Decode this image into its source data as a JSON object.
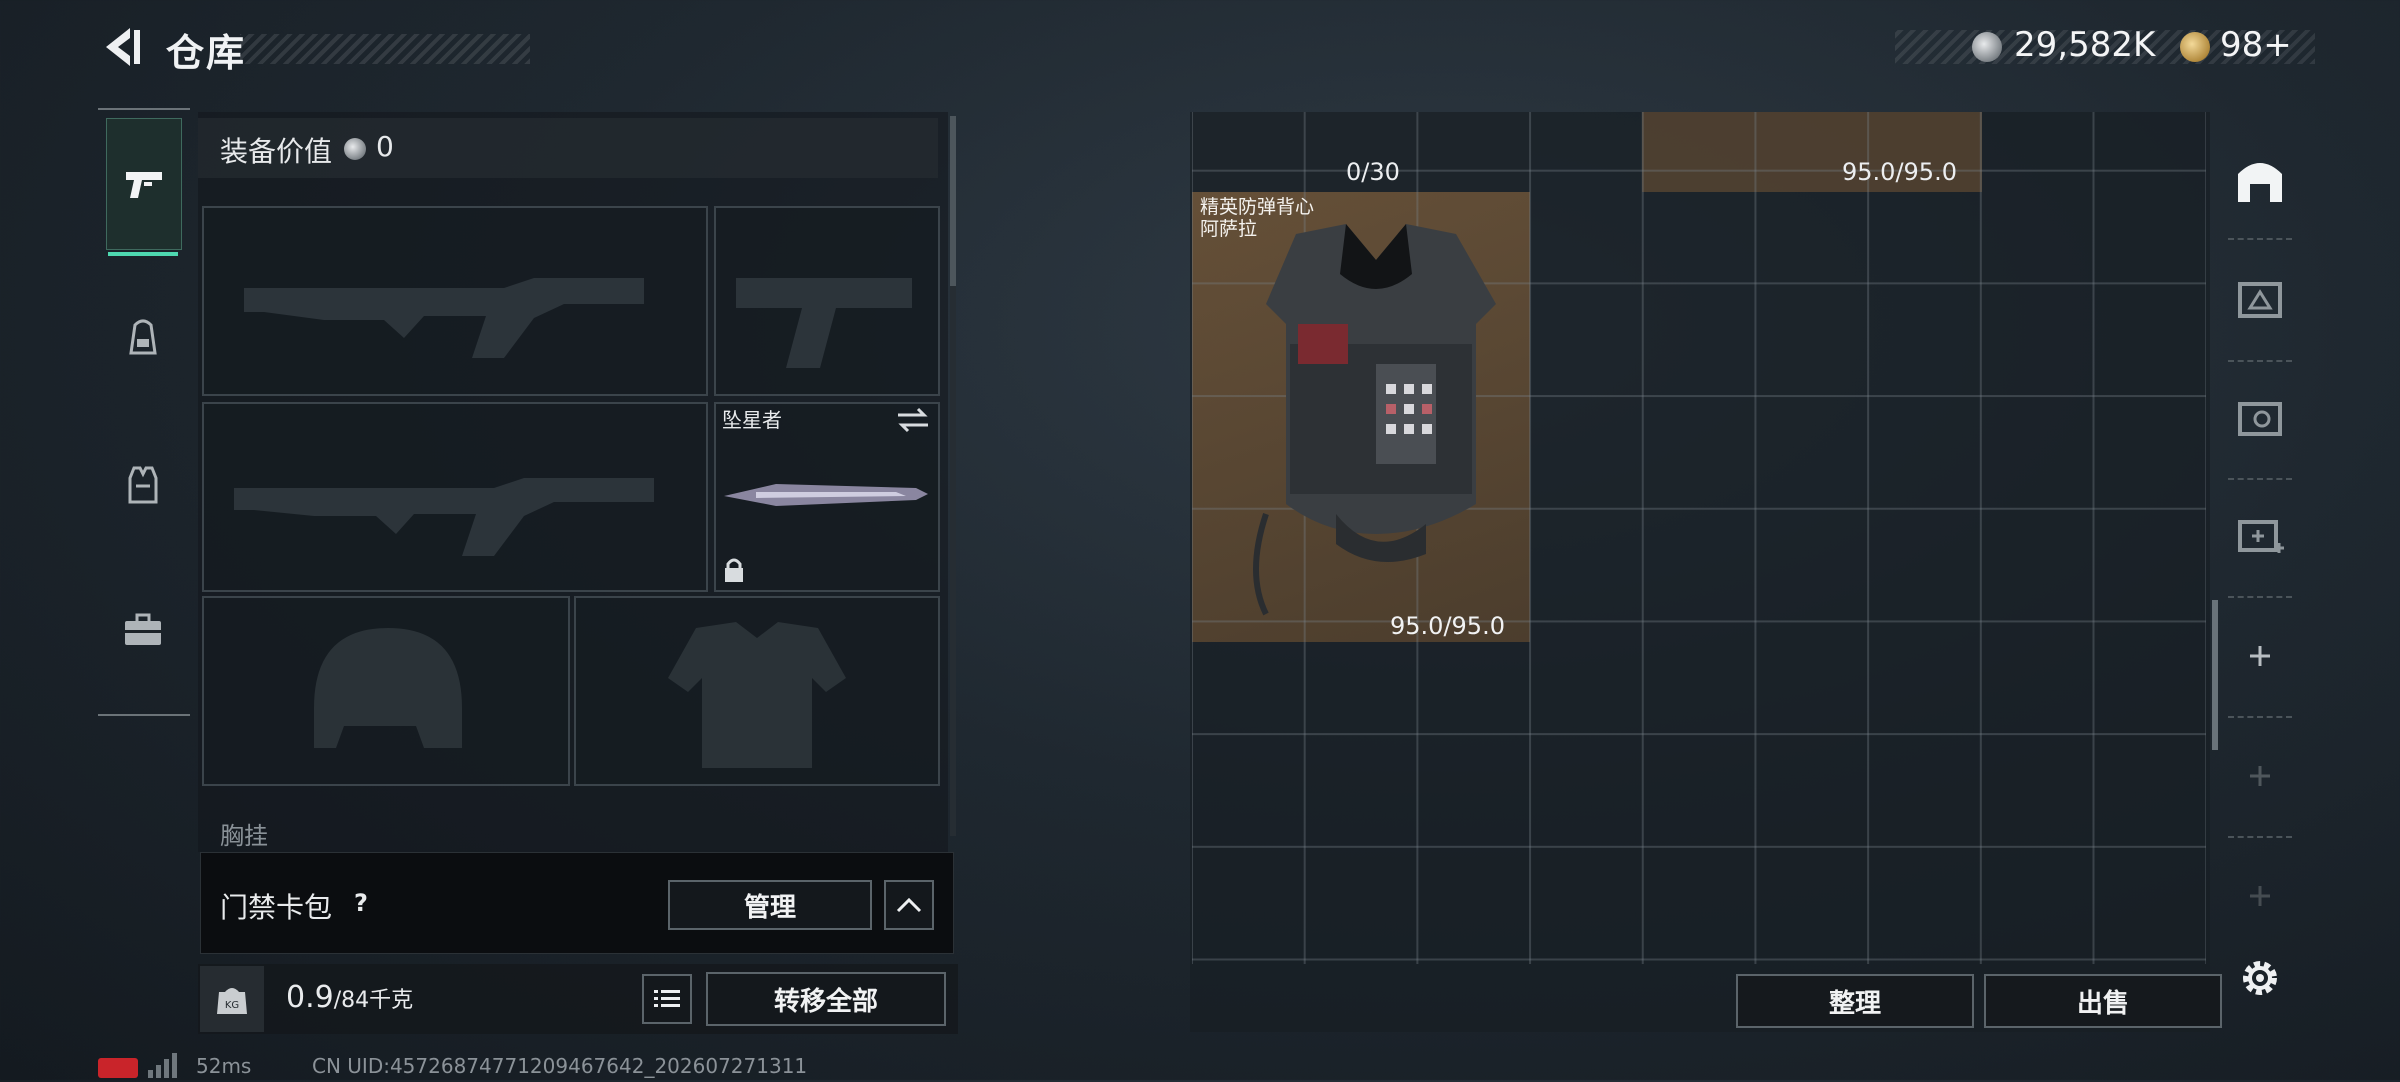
{
  "header": {
    "title": "仓库",
    "money": "29,582K",
    "tickets": "98+"
  },
  "nav": {
    "items": [
      "weapons",
      "backpack",
      "armor",
      "case"
    ],
    "selected": "weapons"
  },
  "equipment": {
    "value_label": "装备价值",
    "value": "0",
    "melee_name": "坠星者",
    "next_section_label": "胸挂"
  },
  "keycard": {
    "label": "门禁卡包",
    "help": "?",
    "manage_label": "管理"
  },
  "weight": {
    "current": "0.9",
    "max": "/84千克",
    "transfer_label": "转移全部"
  },
  "status": {
    "ping": "52ms",
    "uid": "CN UID:4572687477120946764​2_202607271311"
  },
  "storage": {
    "items": [
      {
        "durability": "0/30"
      },
      {
        "durability": "95.0/95.0"
      },
      {
        "name_line1": "精英防弹背心",
        "name_line2": "阿萨拉",
        "durability": "95.0/95.0"
      }
    ],
    "sort_label": "整理",
    "sell_label": "出售"
  },
  "colors": {
    "accent": "#4ed8b0",
    "item_bg": "#7d5e3c"
  }
}
